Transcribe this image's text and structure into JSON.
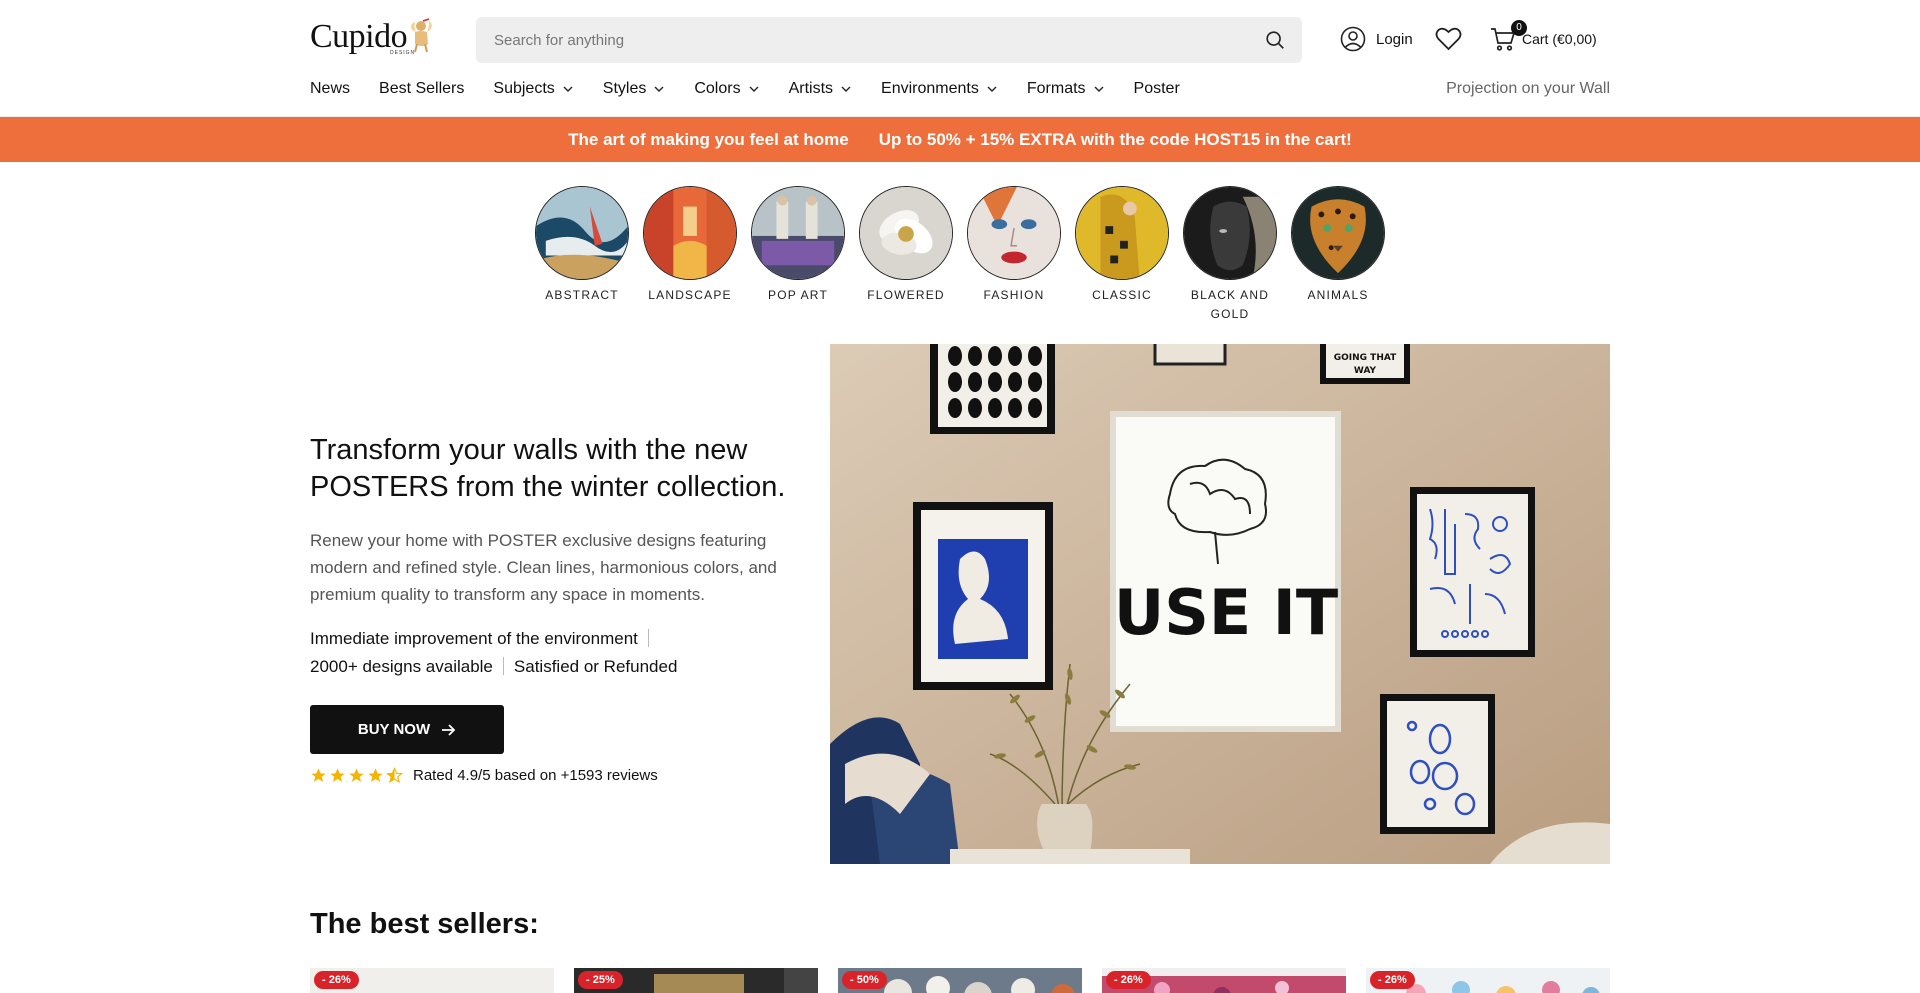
{
  "header": {
    "logo": "Cupido",
    "logo_sub": "DESIGN",
    "search_placeholder": "Search for anything",
    "login_label": "Login",
    "cart_label": "Cart (€0,00)",
    "cart_count": "0"
  },
  "nav": {
    "items": [
      {
        "label": "News",
        "dropdown": false
      },
      {
        "label": "Best Sellers",
        "dropdown": false
      },
      {
        "label": "Subjects",
        "dropdown": true
      },
      {
        "label": "Styles",
        "dropdown": true
      },
      {
        "label": "Colors",
        "dropdown": true
      },
      {
        "label": "Artists",
        "dropdown": true
      },
      {
        "label": "Environments",
        "dropdown": true
      },
      {
        "label": "Formats",
        "dropdown": true
      },
      {
        "label": "Poster",
        "dropdown": false
      }
    ],
    "right_link": "Projection on your Wall"
  },
  "promo": {
    "text1": "The art of making you feel at home",
    "text2": "Up to 50% + 15% EXTRA with the code HOST15 in the cart!",
    "color": "#ef6f3c"
  },
  "categories": [
    {
      "label": "ABSTRACT"
    },
    {
      "label": "LANDSCAPE"
    },
    {
      "label": "POP ART"
    },
    {
      "label": "FLOWERED"
    },
    {
      "label": "FASHION"
    },
    {
      "label": "CLASSIC"
    },
    {
      "label": "BLACK AND GOLD"
    },
    {
      "label": "ANIMALS"
    }
  ],
  "hero": {
    "title": "Transform your walls with the new POSTERS from the winter collection.",
    "description": "Renew your home with POSTER exclusive designs featuring modern and refined style. Clean lines, harmonious colors, and premium quality to transform any space in moments.",
    "feature1": "Immediate improvement of the environment",
    "feature2": "2000+ designs available",
    "feature3": "Satisfied or Refunded",
    "button_label": "BUY NOW",
    "rating_text": "Rated 4.9/5 based on +1593 reviews",
    "rating_value": 4.5,
    "rating_max": 5,
    "poster_text": "USE IT",
    "poster_text2": "YOU'RE NOT GOING THAT WAY"
  },
  "best_sellers": {
    "title": "The best sellers:",
    "products": [
      {
        "badge": "- 26%"
      },
      {
        "badge": "- 25%"
      },
      {
        "badge": "- 50%"
      },
      {
        "badge": "- 26%"
      },
      {
        "badge": "- 26%"
      }
    ]
  }
}
